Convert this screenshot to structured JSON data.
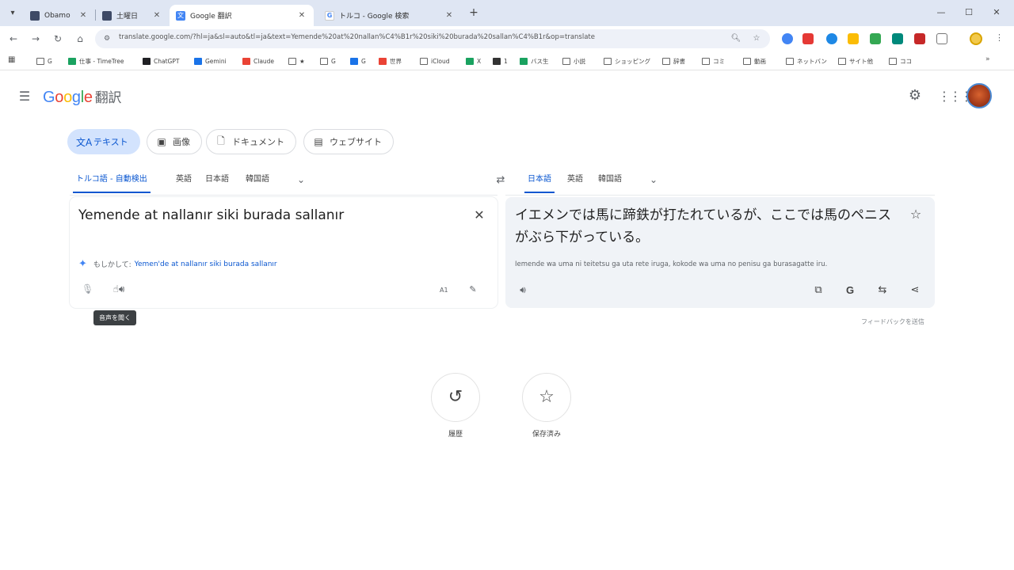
{
  "browser": {
    "tabs": [
      {
        "label": "Obamo",
        "favicon": "doc-icon",
        "active": false
      },
      {
        "label": "土曜日",
        "favicon": "doc-icon",
        "active": false
      },
      {
        "label": "Google 翻訳",
        "favicon": "translate-icon",
        "active": true
      },
      {
        "label": "トルコ - Google 検索",
        "favicon": "google-icon",
        "active": false
      }
    ],
    "new_tab": "+",
    "url": "translate.google.com/?hl=ja&sl=auto&tl=ja&text=Yemende%20at%20nallan%C4%B1r%20siki%20burada%20sallan%C4%B1r&op=translate",
    "bookmarks": [
      {
        "label": "G",
        "icon": "folder-icon"
      },
      {
        "label": "仕事 - TimeTree",
        "icon": "timetree-icon"
      },
      {
        "label": "ChatGPT",
        "icon": "chatgpt-icon"
      },
      {
        "label": "Gemini",
        "icon": "gemini-icon"
      },
      {
        "label": "Claude",
        "icon": "claude-icon"
      },
      {
        "label": "★",
        "icon": "folder-icon"
      },
      {
        "label": "G",
        "icon": "google-icon"
      },
      {
        "label": "G",
        "icon": "google-icon"
      },
      {
        "label": "世界",
        "icon": "gmail-icon"
      },
      {
        "label": "iCloud",
        "icon": "icloud-icon"
      },
      {
        "label": "X",
        "icon": "x-icon"
      },
      {
        "label": "1",
        "icon": "x-icon"
      },
      {
        "label": "バス生",
        "icon": "sheet-icon"
      },
      {
        "label": "小説",
        "icon": "folder-icon"
      },
      {
        "label": "ショッピング",
        "icon": "folder-icon"
      },
      {
        "label": "辞書",
        "icon": "folder-icon"
      },
      {
        "label": "コミ",
        "icon": "folder-icon"
      },
      {
        "label": "動画",
        "icon": "folder-icon"
      },
      {
        "label": "ネットバン",
        "icon": "folder-icon"
      },
      {
        "label": "サイト他",
        "icon": "folder-icon"
      },
      {
        "label": "ココ",
        "icon": "folder-icon"
      }
    ]
  },
  "header": {
    "logo_google": "Google",
    "logo_suffix": "翻訳"
  },
  "modes": [
    {
      "label": "テキスト",
      "icon": "translate-icon",
      "active": true
    },
    {
      "label": "画像",
      "icon": "image-icon",
      "active": false
    },
    {
      "label": "ドキュメント",
      "icon": "document-icon",
      "active": false
    },
    {
      "label": "ウェブサイト",
      "icon": "website-icon",
      "active": false
    }
  ],
  "source_langs": [
    {
      "label": "トルコ語 - 自動検出",
      "active": true
    },
    {
      "label": "英語",
      "active": false
    },
    {
      "label": "日本語",
      "active": false
    },
    {
      "label": "韓国語",
      "active": false
    }
  ],
  "target_langs": [
    {
      "label": "日本語",
      "active": true
    },
    {
      "label": "英語",
      "active": false
    },
    {
      "label": "韓国語",
      "active": false
    }
  ],
  "source": {
    "text": "Yemende at nallanır siki burada sallanır",
    "suggestion_prefix": "もしかして:",
    "suggestion": "Yemen'de at nallanır siki burada sallanır",
    "char_count": "A1",
    "tooltip": "音声を聞く"
  },
  "target": {
    "text": "イエメンでは馬に蹄鉄が打たれているが、ここでは馬のペニスがぶら下がっている。",
    "transliteration": "Iemende wa uma ni teitetsu ga uta rete iruga, kokode wa uma no penisu ga burasagatte iru.",
    "feedback": "フィードバックを送信"
  },
  "bottom": {
    "history_label": "履歴",
    "saved_label": "保存済み"
  },
  "colors": {
    "accent": "#0b57d0",
    "active_chip": "#d3e3fd",
    "target_panel": "#f0f3f7",
    "tab_strip": "#dfe6f3"
  }
}
